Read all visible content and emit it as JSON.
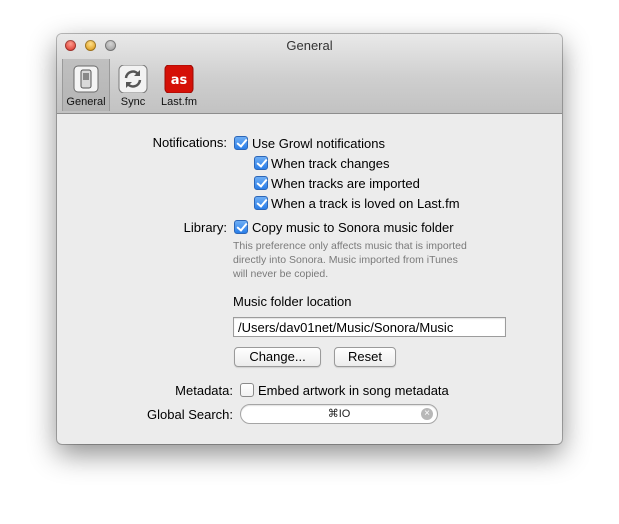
{
  "window": {
    "title": "General"
  },
  "toolbar": {
    "items": [
      {
        "label": "General",
        "icon": "general-switch-icon",
        "selected": true
      },
      {
        "label": "Sync",
        "icon": "sync-icon",
        "selected": false
      },
      {
        "label": "Last.fm",
        "icon": "lastfm-icon",
        "selected": false,
        "icon_text": "as"
      }
    ]
  },
  "notifications": {
    "label": "Notifications:",
    "use_growl": {
      "label": "Use Growl notifications",
      "checked": true
    },
    "track_changes": {
      "label": "When track changes",
      "checked": true
    },
    "tracks_imported": {
      "label": "When tracks are imported",
      "checked": true
    },
    "track_loved": {
      "label": "When a track is loved on Last.fm",
      "checked": true
    }
  },
  "library": {
    "label": "Library:",
    "copy_music": {
      "label": "Copy music to Sonora music folder",
      "checked": true
    },
    "note_lines": [
      "This preference only affects music that is imported",
      "directly into Sonora. Music imported from iTunes",
      "will never be copied."
    ],
    "folder_location_label": "Music folder location",
    "folder_path": "/Users/dav01net/Music/Sonora/Music",
    "change_button": "Change...",
    "reset_button": "Reset"
  },
  "metadata": {
    "label": "Metadata:",
    "embed_artwork": {
      "label": "Embed artwork in song metadata",
      "checked": false
    }
  },
  "global_search": {
    "label": "Global Search:",
    "shortcut": "⌘IO"
  },
  "colors": {
    "checkbox_accent": "#2a7ee8",
    "lastfm_red": "#d51007"
  }
}
